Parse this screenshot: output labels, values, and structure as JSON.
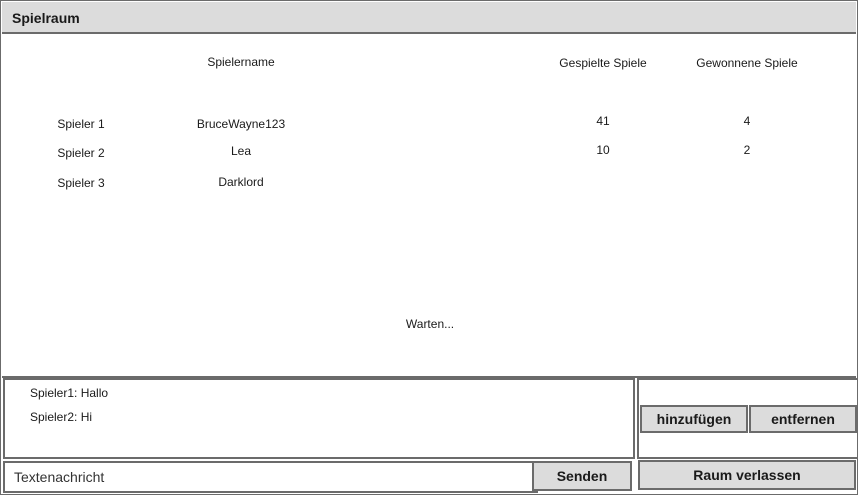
{
  "window": {
    "title": "Spielraum"
  },
  "table": {
    "headers": {
      "name": "Spielername",
      "played": "Gespielte Spiele",
      "won": "Gewonnene Spiele"
    },
    "rows": [
      {
        "label": "Spieler 1",
        "name": "BruceWayne123",
        "played": "41",
        "won": "4"
      },
      {
        "label": "Spieler 2",
        "name": "Lea",
        "played": "10",
        "won": "2"
      },
      {
        "label": "Spieler 3",
        "name": "Darklord",
        "played": "",
        "won": ""
      }
    ]
  },
  "status": "Warten...",
  "chat": {
    "messages": [
      "Spieler1: Hallo",
      "Spieler2: Hi"
    ]
  },
  "controls": {
    "add_label": "hinzufügen",
    "remove_label": "entfernen",
    "message_placeholder": "Textenachricht",
    "send_label": "Senden",
    "leave_label": "Raum verlassen"
  }
}
